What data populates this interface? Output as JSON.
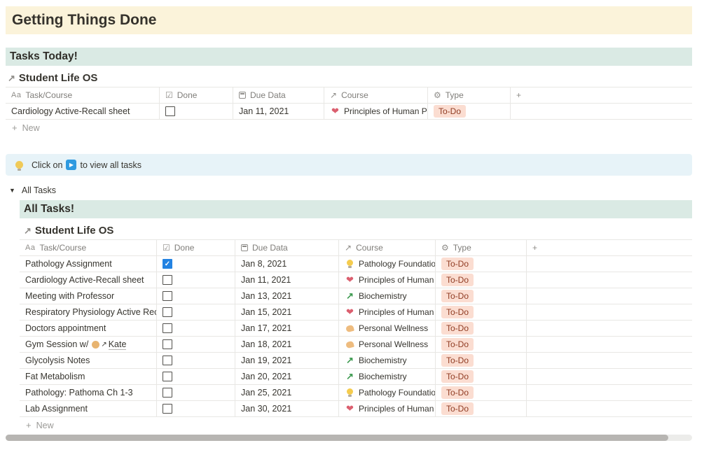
{
  "page_title": "Getting Things Done",
  "icons": {
    "arrow_ne": "↗",
    "toggle_down": "▼",
    "plus": "+",
    "play": "▶",
    "title_col": "Aa",
    "done_col": "☑",
    "type_col": "⚙"
  },
  "columns": {
    "task": "Task/Course",
    "done": "Done",
    "due": "Due Data",
    "course": "Course",
    "type": "Type"
  },
  "new_label": "New",
  "tasks_today": {
    "banner": "Tasks Today!",
    "db_title": "Student Life OS"
  },
  "callout": {
    "text_before": "Click on",
    "text_after": "to view all tasks"
  },
  "toggle_label": "All Tasks",
  "all_tasks": {
    "banner": "All Tasks!",
    "db_title": "Student Life OS"
  },
  "today_rows": [
    {
      "task": "Cardiology Active-Recall sheet",
      "done": false,
      "due": "Jan 11, 2021",
      "course": "Principles of Human Phys",
      "course_icon": "heart",
      "type": "To-Do"
    }
  ],
  "all_rows": [
    {
      "task": "Pathology Assignment",
      "done": true,
      "due": "Jan 8, 2021",
      "course": "Pathology Foundations",
      "course_icon": "bulb",
      "type": "To-Do"
    },
    {
      "task": "Cardiology Active-Recall sheet",
      "done": false,
      "due": "Jan 11, 2021",
      "course": "Principles of Human Phys",
      "course_icon": "heart",
      "type": "To-Do"
    },
    {
      "task": "Meeting with Professor",
      "done": false,
      "due": "Jan 13, 2021",
      "course": "Biochemistry",
      "course_icon": "chart",
      "type": "To-Do"
    },
    {
      "task": "Respiratory Physiology Active Recall",
      "done": false,
      "due": "Jan 15, 2021",
      "course": "Principles of Human Phys",
      "course_icon": "heart",
      "type": "To-Do"
    },
    {
      "task": "Doctors appointment",
      "done": false,
      "due": "Jan 17, 2021",
      "course": "Personal Wellness",
      "course_icon": "muscle",
      "type": "To-Do"
    },
    {
      "task": "Gym Session w/",
      "mention": "Kate",
      "done": false,
      "due": "Jan 18, 2021",
      "course": "Personal Wellness",
      "course_icon": "muscle",
      "type": "To-Do"
    },
    {
      "task": "Glycolysis Notes",
      "done": false,
      "due": "Jan 19, 2021",
      "course": "Biochemistry",
      "course_icon": "chart",
      "type": "To-Do"
    },
    {
      "task": "Fat Metabolism",
      "done": false,
      "due": "Jan 20, 2021",
      "course": "Biochemistry",
      "course_icon": "chart",
      "type": "To-Do"
    },
    {
      "task": "Pathology: Pathoma Ch 1-3",
      "done": false,
      "due": "Jan 25, 2021",
      "course": "Pathology Foundations",
      "course_icon": "bulb",
      "type": "To-Do"
    },
    {
      "task": "Lab Assignment",
      "done": false,
      "due": "Jan 30, 2021",
      "course": "Principles of Human Phys",
      "course_icon": "heart",
      "type": "To-Do"
    }
  ]
}
